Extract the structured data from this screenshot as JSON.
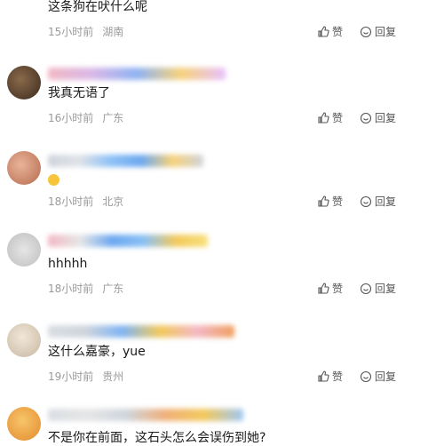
{
  "comments": [
    {
      "text": "这条狗在吠什么呢",
      "time": "15小时前",
      "location": "湖南",
      "like_label": "赞",
      "reply_label": "回复"
    },
    {
      "text": "我真无语了",
      "time": "16小时前",
      "location": "广东",
      "like_label": "赞",
      "reply_label": "回复"
    },
    {
      "text": "",
      "time": "18小时前",
      "location": "北京",
      "like_label": "赞",
      "reply_label": "回复",
      "emoji": "fearful-face"
    },
    {
      "text": "hhhhh",
      "time": "18小时前",
      "location": "广东",
      "like_label": "赞",
      "reply_label": "回复"
    },
    {
      "text": "这什么嘉豪，yue",
      "time": "19小时前",
      "location": "贵州",
      "like_label": "赞",
      "reply_label": "回复"
    },
    {
      "text": "不是你在前面，这石头怎么会误伤到她?",
      "time": "",
      "location": "",
      "like_label": "",
      "reply_label": ""
    }
  ],
  "colors": {
    "meta": "#9a9a9a",
    "action": "#555555"
  }
}
